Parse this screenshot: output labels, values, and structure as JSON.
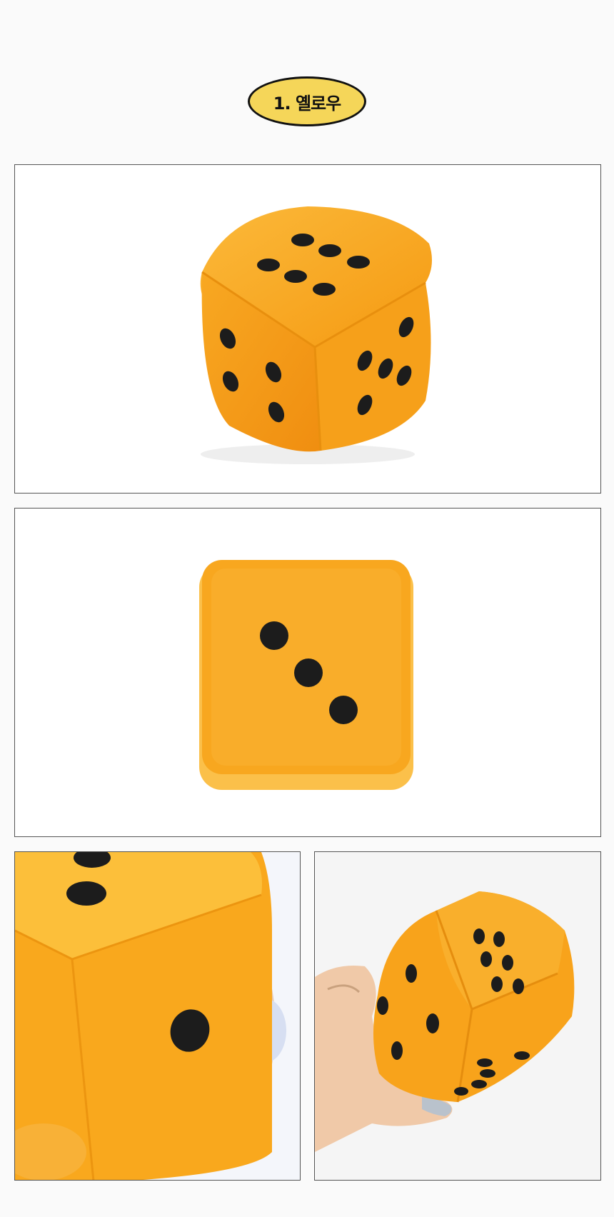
{
  "badge": {
    "label": "1. 옐로우"
  },
  "colors": {
    "dice": "#f8a21c",
    "dice_light": "#fbb93a",
    "pip": "#1c1c1c",
    "badge_fill": "#f5d659"
  },
  "photos": [
    {
      "id": "photo-dice-angle",
      "faces_shown": [
        6,
        4,
        5
      ]
    },
    {
      "id": "photo-dice-front",
      "faces_shown": [
        3
      ]
    },
    {
      "id": "photo-dice-closeup"
    },
    {
      "id": "photo-dice-in-hand"
    }
  ]
}
